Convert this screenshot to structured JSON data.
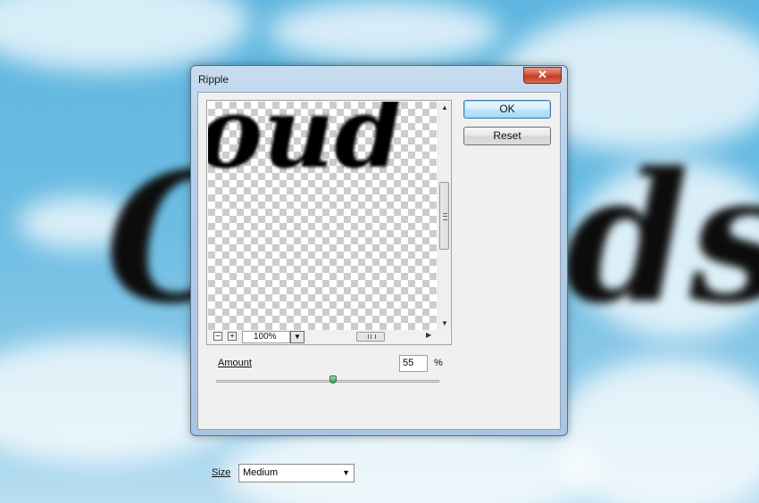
{
  "dialog": {
    "title": "Ripple",
    "close_glyph": "✕",
    "buttons": {
      "ok_label": "OK",
      "reset_label": "Reset"
    },
    "preview": {
      "text": "oud",
      "zoom_level": "100%",
      "zoom_out_glyph": "−",
      "zoom_in_glyph": "+"
    },
    "amount": {
      "label": "Amount",
      "value": "55",
      "unit": "%",
      "slider_fraction": 0.55
    },
    "size": {
      "label": "Size",
      "selected": "Medium"
    }
  },
  "background": {
    "text": "Clouds"
  },
  "icons": {
    "close": "close-icon",
    "zoom_out": "zoom-out-icon",
    "zoom_in": "zoom-in-icon",
    "dropdown": "chevron-down-icon"
  },
  "colors": {
    "sky": "#63b8e0",
    "close_button": "#c9442d",
    "ok_button_border": "#3c7fb1",
    "slider_thumb": "#2e9e4e"
  }
}
